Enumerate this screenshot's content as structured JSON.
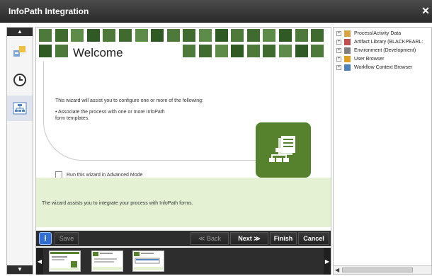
{
  "window": {
    "title": "InfoPath Integration",
    "close_label": "✕"
  },
  "sidebar": {
    "scroll_up": "▲",
    "scroll_down": "▼",
    "icons": [
      "process-icon",
      "clock-icon",
      "wizard-icon"
    ]
  },
  "wizard": {
    "heading": "Welcome",
    "intro": "This wizard will assist you to configure one or more of the following:",
    "bullet": "• Associate the process with one or more InfoPath form templates.",
    "advanced_label": "Run this wizard in Advanced Mode",
    "info_text": "The wizard assists you to integrate your process with InfoPath forms."
  },
  "toolbar": {
    "info_label": "i",
    "save_label": "Save",
    "back_label": "≪ Back",
    "next_label": "Next ≫",
    "finish_label": "Finish",
    "cancel_label": "Cancel"
  },
  "thumbnails": {
    "left_arrow": "◀",
    "right_arrow": "▶"
  },
  "tree": {
    "items": [
      {
        "label": "Process/Activity Data",
        "icon": "data-icon",
        "color": "#d9a441"
      },
      {
        "label": "Artifact Library (BLACKPEARL:",
        "icon": "library-icon",
        "color": "#c0504d"
      },
      {
        "label": "Environment (Development)",
        "icon": "environment-icon",
        "color": "#7f7f7f"
      },
      {
        "label": "User Browser",
        "icon": "user-icon",
        "color": "#e0a020"
      },
      {
        "label": "Workflow Context Browser",
        "icon": "workflow-icon",
        "color": "#4f81bd"
      }
    ]
  },
  "colors": {
    "accent": "#56822e",
    "info_bg": "#e4f2d3",
    "toolbar": "#2d2d2d"
  }
}
